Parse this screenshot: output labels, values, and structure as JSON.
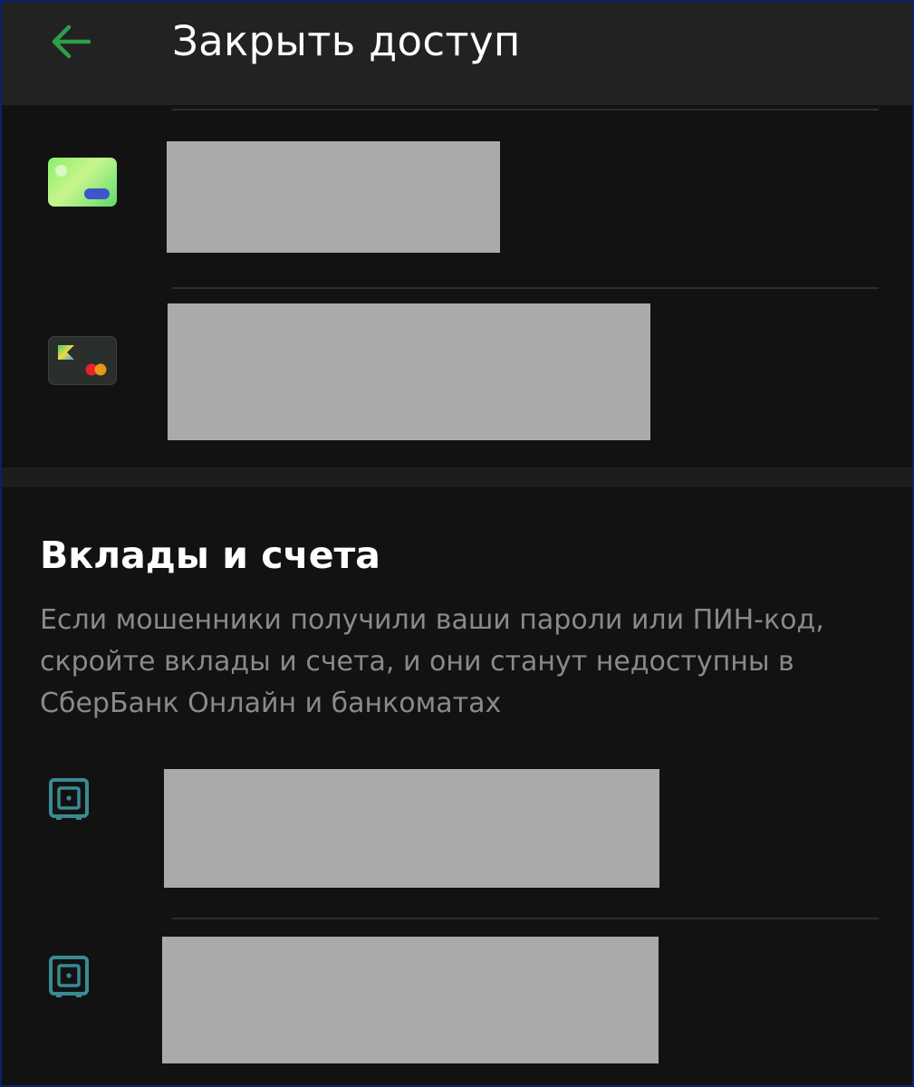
{
  "header": {
    "title": "Закрыть доступ",
    "back_icon": "arrow-left-icon"
  },
  "cards": [
    {
      "icon": "green-card-icon"
    },
    {
      "icon": "dark-card-icon"
    }
  ],
  "section": {
    "title": "Вклады и счета",
    "description": "Если мошенники получили ваши пароли или ПИН-код, скройте вклады и счета, и они станут недоступны в СберБанк Онлайн и банкоматах"
  },
  "deposits": [
    {
      "icon": "safe-icon"
    },
    {
      "icon": "safe-icon"
    }
  ],
  "colors": {
    "background": "#121212",
    "header": "#222222",
    "accent_green": "#2e9e4a",
    "safe_teal": "#3a8a92",
    "redacted": "#aaaaaa",
    "muted_text": "#8a8a8a"
  }
}
